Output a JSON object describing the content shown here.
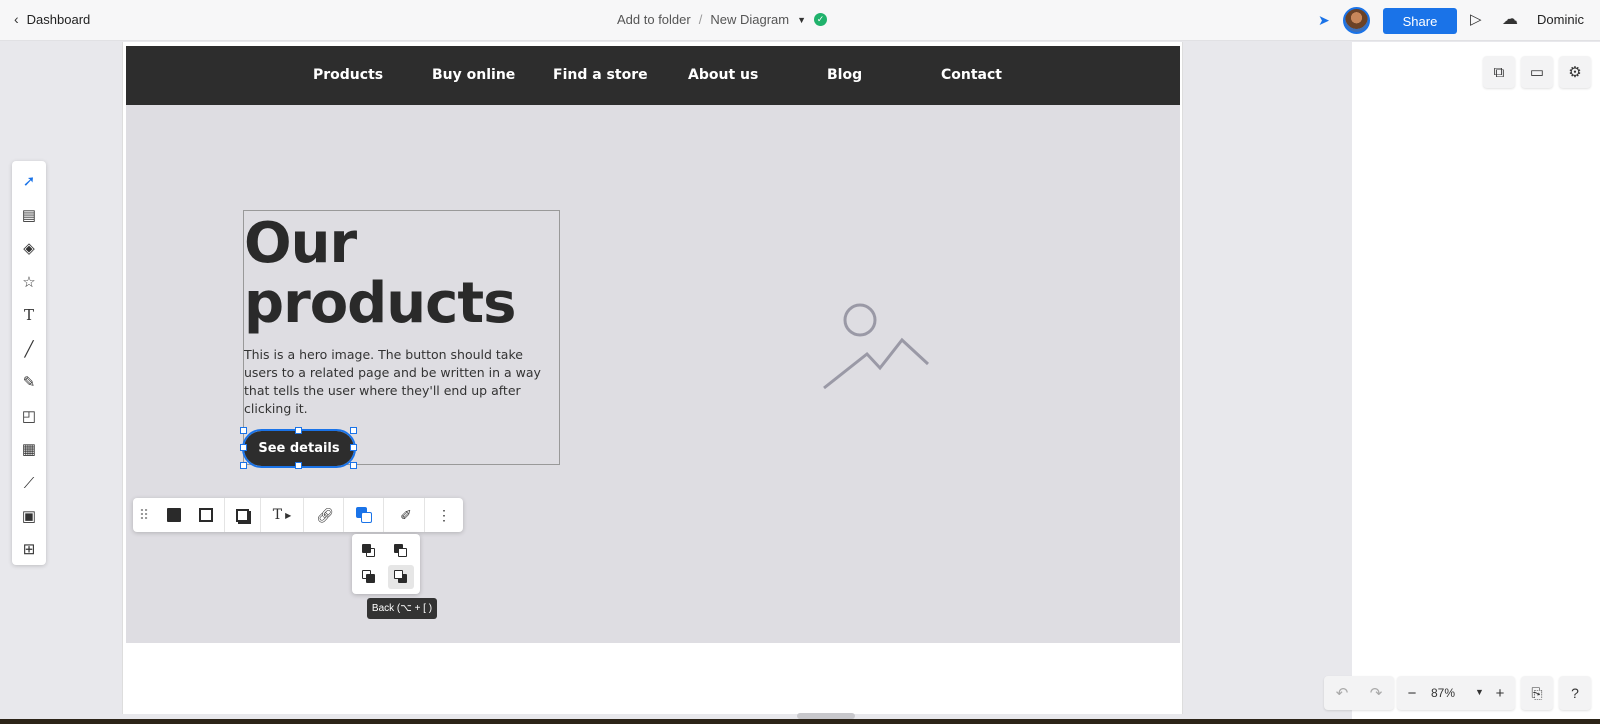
{
  "topbar": {
    "back_label": "Dashboard",
    "crumbs": {
      "folder": "Add to folder",
      "separator": "/",
      "doc": "New Diagram"
    },
    "share_label": "Share",
    "user": "Dominic"
  },
  "site": {
    "nav": [
      "Products",
      "Buy online",
      "Find a store",
      "About us",
      "Blog",
      "Contact"
    ],
    "hero_title_line1": "Our",
    "hero_title_line2": "products",
    "hero_desc": "This is a hero image. The button should take users to a related page and be written in a way that tells the user where they'll end up after clicking it.",
    "cta": "See details"
  },
  "tools": [
    "select-icon",
    "page-icon",
    "shapes-icon",
    "star-icon",
    "text-icon",
    "line-icon",
    "pen-icon",
    "sticky-note-icon",
    "table-icon",
    "chart-icon",
    "image-icon",
    "embed-icon"
  ],
  "order_tooltip": "Back (⌥ + [ )",
  "zoom": "87%",
  "colors": {
    "accent": "#1a73e8",
    "nav_bg": "#2d2d2d",
    "frame_bg": "#dedde2",
    "status_ok": "#20b26c"
  }
}
